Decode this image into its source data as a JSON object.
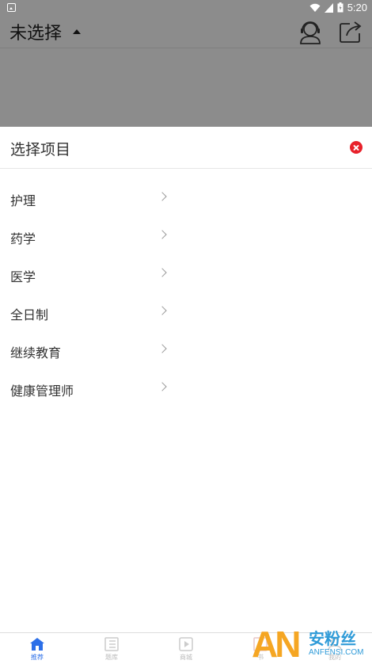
{
  "status_bar": {
    "time": "5:20"
  },
  "header": {
    "project_title": "未选择"
  },
  "sheet": {
    "title": "选择项目",
    "options": [
      {
        "label": "护理"
      },
      {
        "label": "药学"
      },
      {
        "label": "医学"
      },
      {
        "label": "全日制"
      },
      {
        "label": "继续教育"
      },
      {
        "label": "健康管理师"
      }
    ]
  },
  "bottom_nav": [
    {
      "label": "推荐",
      "icon": "home-icon",
      "active": true
    },
    {
      "label": "题库",
      "icon": "question-bank-icon"
    },
    {
      "label": "商城",
      "icon": "video-icon"
    },
    {
      "label": "书",
      "icon": "book-icon"
    },
    {
      "label": "我的",
      "icon": "profile-icon"
    }
  ],
  "watermark": {
    "logo": "AN",
    "cn": "安粉丝",
    "en": "ANFENSI.COM"
  },
  "colors": {
    "accent": "#2c6fe8",
    "close": "#e8212b",
    "dim": "#8c8c8c"
  }
}
